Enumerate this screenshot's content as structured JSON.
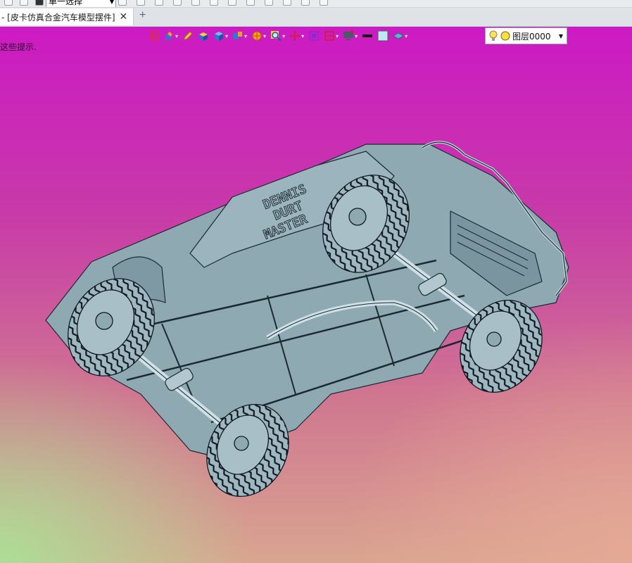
{
  "toolbar_top": {
    "selection_mode": "单一选择"
  },
  "tabs": [
    {
      "label": "- [皮卡仿真合金汽车模型摆件]"
    }
  ],
  "tab_add_label": "+",
  "tab_close_label": "✕",
  "viewport": {
    "hint_text": "这些提示."
  },
  "view_toolbar": {
    "icons": [
      "exit-icon",
      "paint-icon",
      "pencil-icon",
      "box-yellow-icon",
      "cube-icon",
      "cube-pair-icon",
      "render-mode-icon",
      "zoom-icon",
      "pan-icon",
      "frame-icon",
      "section-icon",
      "display-icon",
      "line-color-icon",
      "fill-color-icon",
      "shading-icon"
    ],
    "layer": {
      "label": "图层0000",
      "bulb_color": "#ffe066"
    }
  },
  "model_text": {
    "line1": "DENNIS",
    "line2": "DURT",
    "line3": "MASTER"
  },
  "colors": {
    "model_fill": "#8fa9b3",
    "model_stroke": "#1a2a30",
    "bg_top": "#cc1ac4",
    "bg_bottom_left": "#aae196"
  }
}
